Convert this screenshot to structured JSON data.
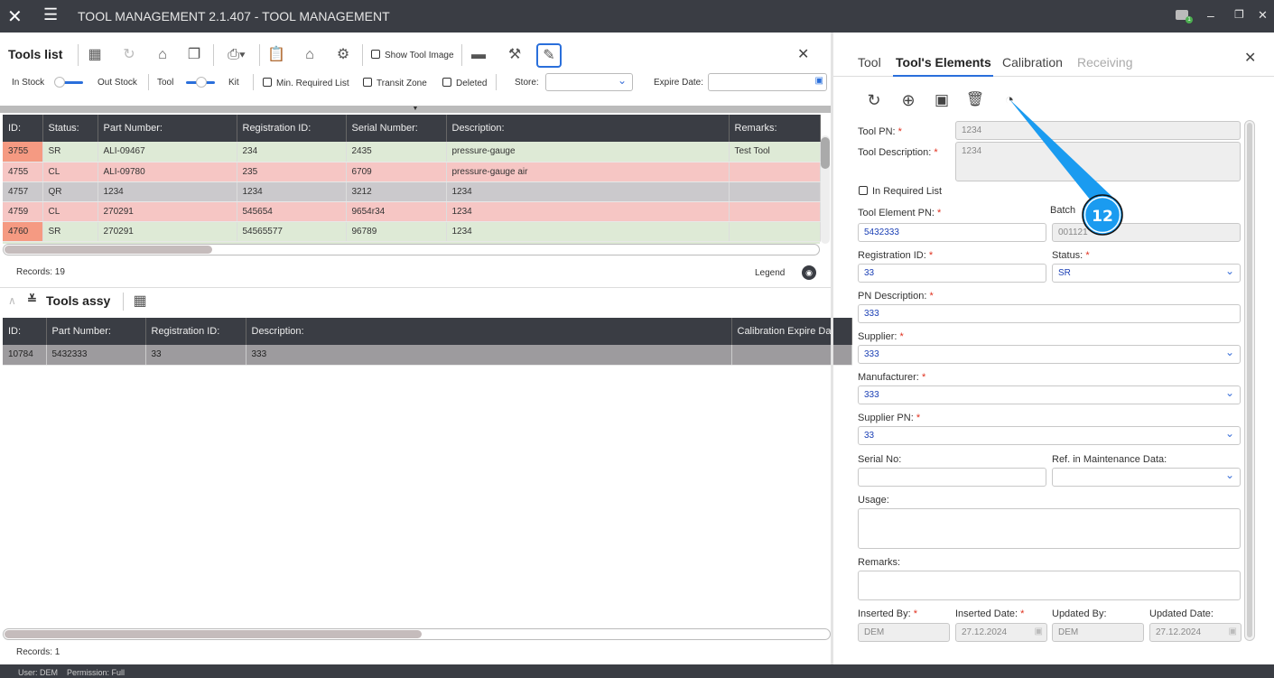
{
  "app": {
    "title": "TOOL MANAGEMENT 2.1.407 - TOOL MANAGEMENT",
    "notification_count": "1"
  },
  "tools_list": {
    "title": "Tools list",
    "show_tool_image": "Show Tool Image",
    "filters": {
      "in_stock": "In Stock",
      "out_stock": "Out Stock",
      "tool": "Tool",
      "kit": "Kit",
      "min_required": "Min. Required List",
      "transit_zone": "Transit Zone",
      "deleted": "Deleted",
      "store_label": "Store:",
      "store_value": "",
      "expire_label": "Expire Date:",
      "expire_value": ""
    },
    "columns": [
      "ID:",
      "Status:",
      "Part Number:",
      "Registration ID:",
      "Serial Number:",
      "Description:",
      "Remarks:"
    ],
    "rows": [
      {
        "id": "3755",
        "status": "SR",
        "part": "ALI-09467",
        "reg": "234",
        "serial": "2435",
        "desc": "pressure-gauge",
        "remarks": "Test Tool",
        "cls": "g",
        "idcls": "idr"
      },
      {
        "id": "4755",
        "status": "CL",
        "part": "ALI-09780",
        "reg": "235",
        "serial": "6709",
        "desc": "pressure-gauge air",
        "remarks": "",
        "cls": "r",
        "idcls": ""
      },
      {
        "id": "4757",
        "status": "QR",
        "part": "1234",
        "reg": "1234",
        "serial": "3212",
        "desc": "1234",
        "remarks": "",
        "cls": "q",
        "idcls": ""
      },
      {
        "id": "4759",
        "status": "CL",
        "part": "270291",
        "reg": "545654",
        "serial": "9654r34",
        "desc": "1234",
        "remarks": "",
        "cls": "r",
        "idcls": ""
      },
      {
        "id": "4760",
        "status": "SR",
        "part": "270291",
        "reg": "54565577",
        "serial": "96789",
        "desc": "1234",
        "remarks": "",
        "cls": "g",
        "idcls": "idr"
      }
    ],
    "records": "Records: 19",
    "legend": "Legend"
  },
  "tools_assy": {
    "title": "Tools assy",
    "columns": [
      "ID:",
      "Part Number:",
      "Registration ID:",
      "Description:",
      "Calibration Expire Da"
    ],
    "rows": [
      {
        "id": "10784",
        "part": "5432333",
        "reg": "33",
        "desc": "333",
        "cal": ""
      }
    ],
    "records": "Records: 1"
  },
  "panel": {
    "tabs": [
      "Tool",
      "Tool's Elements",
      "Calibration",
      "Receiving"
    ],
    "active_tab": 1,
    "form": {
      "tool_pn_label": "Tool PN:",
      "tool_pn": "1234",
      "tool_desc_label": "Tool Description:",
      "tool_desc": "1234",
      "in_required": "In Required List",
      "elem_pn_label": "Tool Element PN:",
      "elem_pn": "5432333",
      "batch_label": "Batch",
      "batch": "001121",
      "reg_label": "Registration ID:",
      "reg": "33",
      "status_label": "Status:",
      "status": "SR",
      "pn_desc_label": "PN Description:",
      "pn_desc": "333",
      "supplier_label": "Supplier:",
      "supplier": "333",
      "manufacturer_label": "Manufacturer:",
      "manufacturer": "333",
      "supplier_pn_label": "Supplier PN:",
      "supplier_pn": "33",
      "serial_label": "Serial No:",
      "serial": "",
      "ref_label": "Ref. in Maintenance Data:",
      "ref": "",
      "usage_label": "Usage:",
      "usage": "",
      "remarks_label": "Remarks:",
      "remarks": "",
      "inserted_by_label": "Inserted By:",
      "inserted_by": "DEM",
      "inserted_date_label": "Inserted Date:",
      "inserted_date": "27.12.2024",
      "updated_by_label": "Updated By:",
      "updated_by": "DEM",
      "updated_date_label": "Updated Date:",
      "updated_date": "27.12.2024"
    }
  },
  "callout": {
    "number": "12",
    "color": "#1a9bf0"
  },
  "statusbar": {
    "user": "User: DEM",
    "permission": "Permission: Full"
  }
}
